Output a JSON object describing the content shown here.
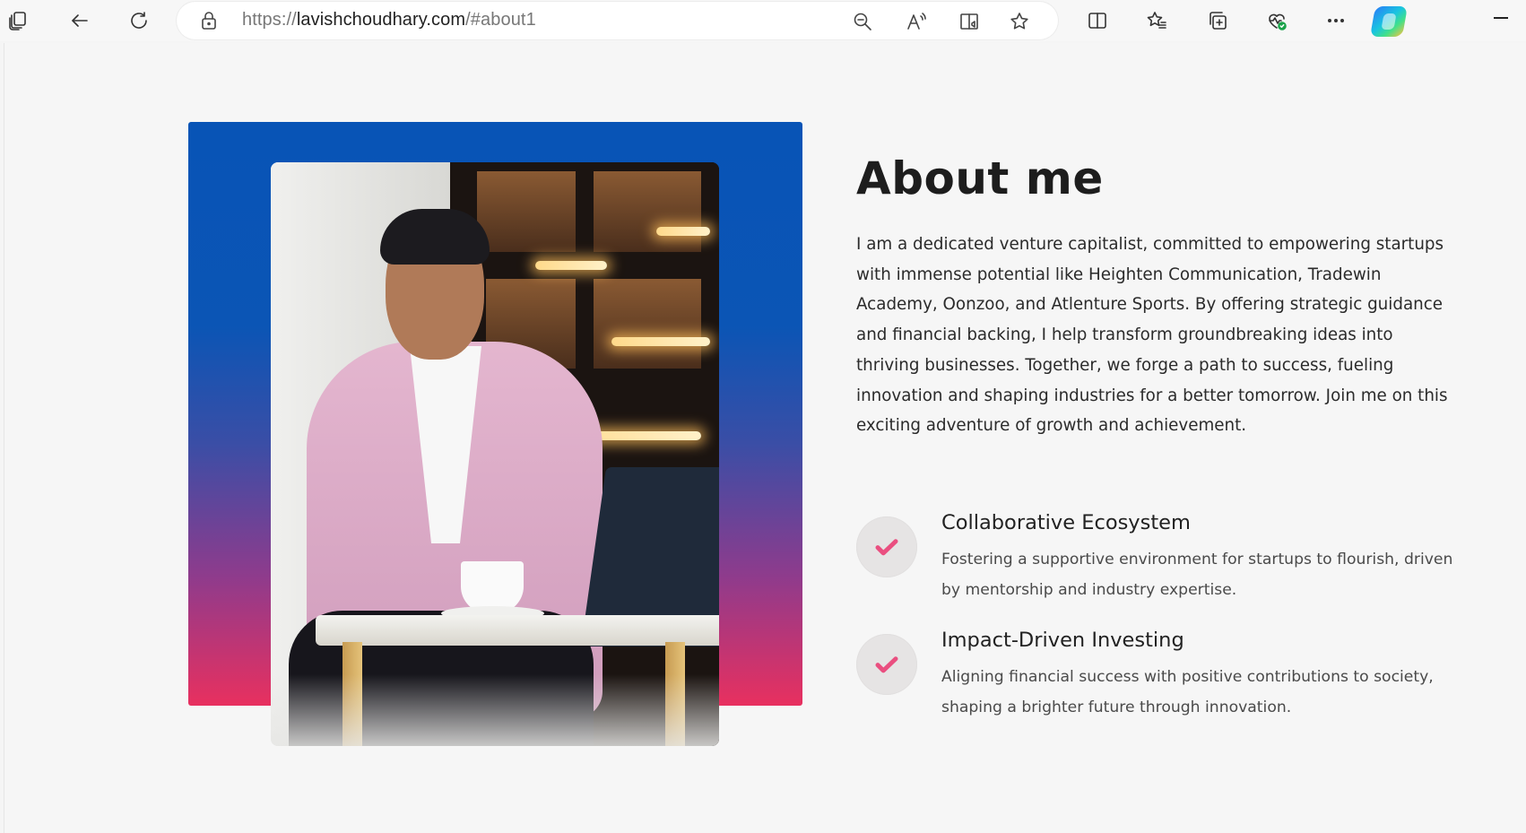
{
  "browser": {
    "url_prefix": "https://",
    "url_host": "lavishchoudhary.com",
    "url_path": "/#about1",
    "icons": [
      "tabs-icon",
      "back-icon",
      "refresh-icon",
      "lock-icon",
      "zoom-icon",
      "read-aloud-icon",
      "immersive-reader-icon",
      "favorite-star-icon",
      "split-screen-icon",
      "favorites-icon",
      "collections-icon",
      "browser-essentials-icon",
      "more-icon",
      "copilot-icon",
      "minimize-icon"
    ]
  },
  "about": {
    "title": "About me",
    "intro": "I am a dedicated venture capitalist, committed to empowering startups with immense potential like Heighten Communication, Tradewin Academy, Oonzoo, and Atlenture Sports. By offering strategic guidance and financial backing, I help transform groundbreaking ideas into thriving businesses. Together, we forge a path to success, fueling innovation and shaping industries for a better tomorrow. Join me on this exciting adventure of growth and achievement.",
    "features": [
      {
        "title": "Collaborative Ecosystem",
        "description": "Fostering a supportive environment for startups to flourish, driven by mentorship and industry expertise."
      },
      {
        "title": "Impact-Driven Investing",
        "description": "Aligning financial success with positive contributions to society, shaping a brighter future through innovation."
      }
    ]
  },
  "colors": {
    "panel_top": "#0854b6",
    "panel_bottom": "#e8305f",
    "check_accent": "#ea4f80"
  }
}
